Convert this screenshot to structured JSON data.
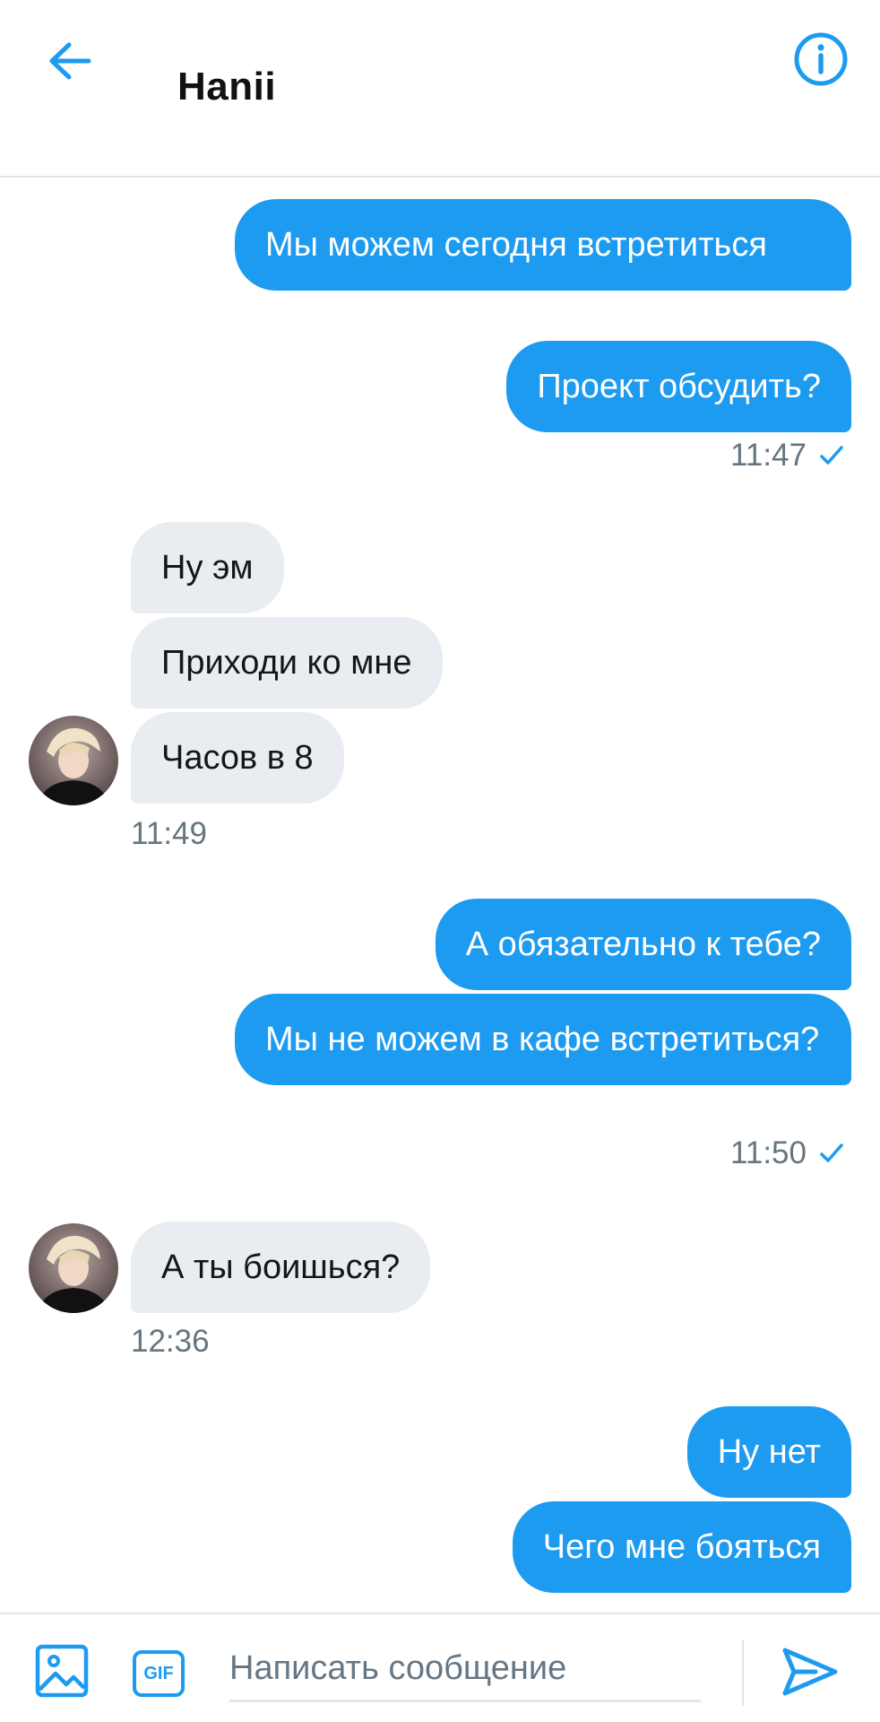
{
  "header": {
    "title": "Hanii",
    "back_icon": "arrow-left-icon",
    "info_icon": "info-icon",
    "accent_color": "#1d9bf0"
  },
  "messages": [
    {
      "direction": "out",
      "text": "Мы можем сегодня встретиться"
    },
    {
      "direction": "out",
      "text": "Проект обсудить?"
    },
    {
      "time": "11:47",
      "status_icon": "check-icon"
    },
    {
      "direction": "in",
      "text": "Ну эм"
    },
    {
      "direction": "in",
      "text": "Приходи ко мне"
    },
    {
      "direction": "in",
      "text": "Часов в 8"
    },
    {
      "time": "11:49"
    },
    {
      "direction": "out",
      "text": "А обязательно к тебе?"
    },
    {
      "direction": "out",
      "text": "Мы не можем в кафе встретиться?"
    },
    {
      "time": "11:50",
      "status_icon": "check-icon"
    },
    {
      "direction": "in",
      "text": "А ты боишься?"
    },
    {
      "time": "12:36"
    },
    {
      "direction": "out",
      "text": "Ну нет"
    },
    {
      "direction": "out",
      "text": "Чего мне бояться"
    }
  ],
  "composer": {
    "placeholder": "Написать сообщение",
    "gif_label": "GIF",
    "media_icon": "image-icon",
    "send_icon": "send-icon"
  },
  "colors": {
    "outgoing_bubble": "#1d9bf0",
    "incoming_bubble": "#e9edf1",
    "timestamp": "#66757f"
  }
}
